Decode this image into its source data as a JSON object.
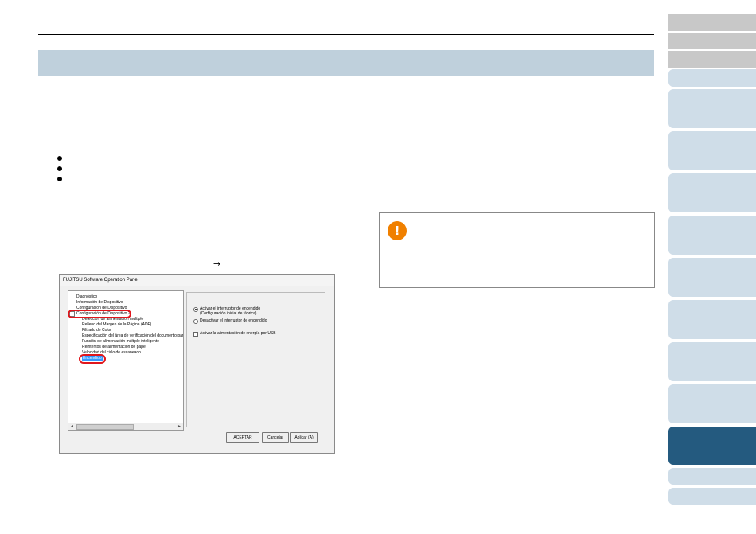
{
  "dialog": {
    "title": "FUJITSU Software Operation Panel",
    "tree": {
      "items": [
        "Diagnóstico",
        "Información de Dispositivo",
        "Configuración de Dispositivo",
        "Configuración de Dispositivo 2",
        "Detección de alimentación múltiple",
        "Relleno del Margen de la Página (ADF)",
        "Filtrado de Color",
        "Especificación del área de verificación del documento par",
        "Función de alimentación múltiple inteligente",
        "Reintentos de alimentación de papel",
        "Velocidad del ciclo de escaneado",
        "Encendido"
      ],
      "expander": "−",
      "scroll_left": "◄",
      "scroll_right": "►"
    },
    "options": {
      "power_on_switch": "Activar el interruptor de encendido",
      "power_on_switch_note": "(Configuración inicial de fábrica)",
      "power_off_switch": "Desactivar el interruptor de encendido",
      "usb_power": "Activar la alimentación de energía por USB"
    },
    "buttons": {
      "ok": "ACEPTAR",
      "cancel": "Cancelar",
      "apply": "Aplicar (A)"
    }
  },
  "arrow": "→",
  "caution_icon": "!",
  "colors": {
    "title_band": "#bfd0dc",
    "active_tab": "#245a7f",
    "highlight": "#e0161c",
    "caution": "#f08000"
  }
}
